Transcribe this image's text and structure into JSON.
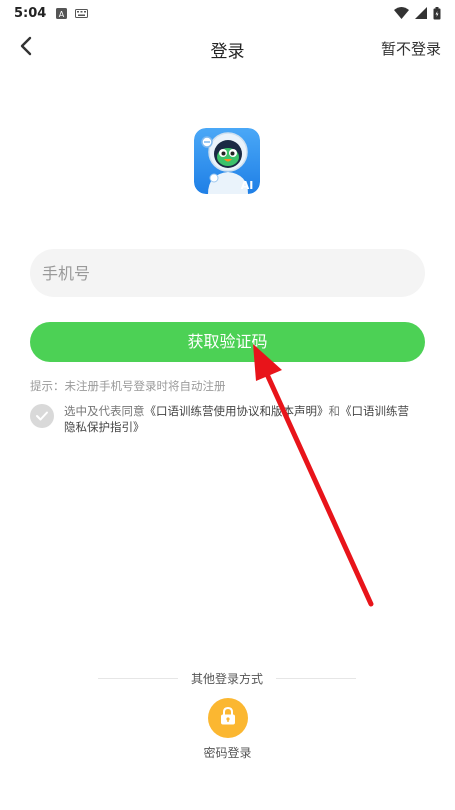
{
  "status_bar": {
    "time": "5:04",
    "icons": [
      "a-notification-icon",
      "keyboard-icon",
      "wifi-icon",
      "signal-icon",
      "battery-icon"
    ]
  },
  "header": {
    "title": "登录",
    "skip_label": "暂不登录",
    "back_icon": "chevron-left-icon"
  },
  "logo": {
    "badge_text": "AI",
    "bg_color": "#2a8ff0"
  },
  "form": {
    "phone_placeholder": "手机号",
    "phone_value": "",
    "get_code_label": "获取验证码",
    "hint": "提示：未注册手机号登录时将自动注册",
    "agreement": {
      "prefix": "选中及代表同意",
      "link1": "《口语训练营使用协议和版本声明》",
      "joiner": "和",
      "link2": "《口语训练营隐私保护指引》",
      "checked": false
    }
  },
  "other_login": {
    "title": "其他登录方式",
    "password_login_label": "密码登录",
    "icon": "lock-icon"
  },
  "colors": {
    "primary_green": "#4cd155",
    "lock_yellow": "#fbb731",
    "annotation_red": "#e8141a"
  }
}
